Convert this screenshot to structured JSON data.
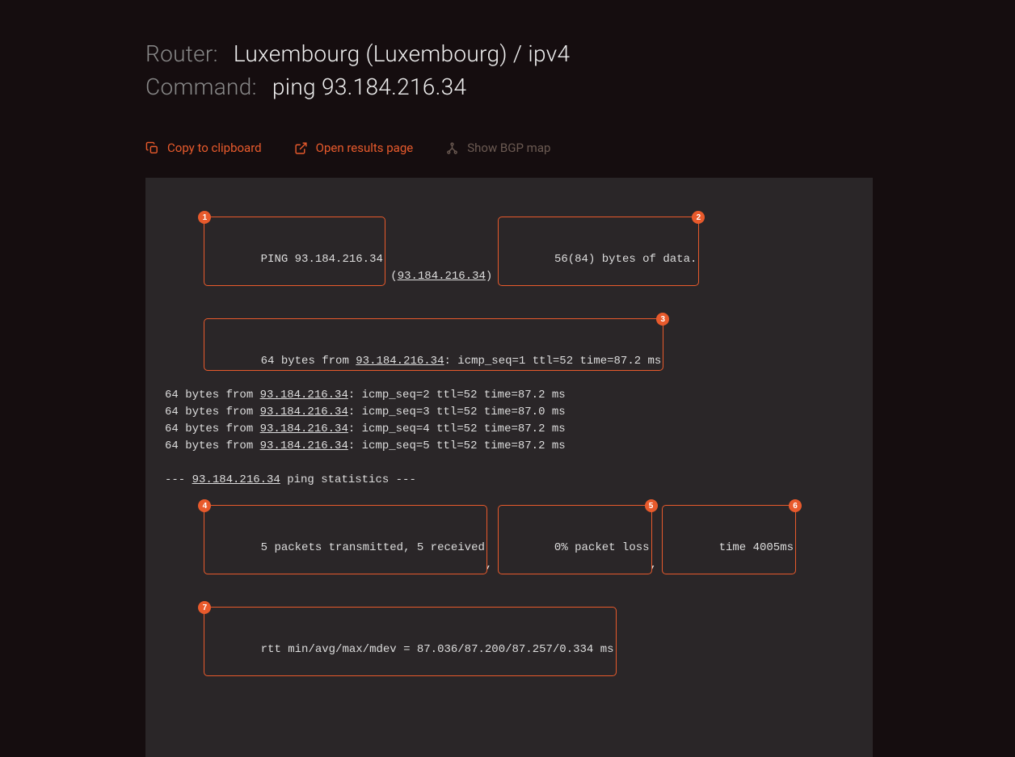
{
  "header": {
    "router_label": "Router:",
    "router_value": "Luxembourg (Luxembourg) / ipv4",
    "command_label": "Command:",
    "command_value": "ping 93.184.216.34"
  },
  "actions": {
    "copy": "Copy to clipboard",
    "open": "Open results page",
    "bgp": "Show BGP map"
  },
  "output": {
    "ip": "93.184.216.34",
    "line1_a": "PING 93.184.216.34",
    "line1_b": "56(84) bytes of data.",
    "line2": "64 bytes from 93.184.216.34: icmp_seq=1 ttl=52 time=87.2 ms",
    "seq_prefix": "64 bytes from ",
    "seq2": ": icmp_seq=2 ttl=52 time=87.2 ms",
    "seq3": ": icmp_seq=3 ttl=52 time=87.0 ms",
    "seq4": ": icmp_seq=4 ttl=52 time=87.2 ms",
    "seq5": ": icmp_seq=5 ttl=52 time=87.2 ms",
    "stats_title_a": "--- ",
    "stats_title_b": " ping statistics ---",
    "stats_a": "5 packets transmitted, 5 received",
    "stats_b": "0% packet loss",
    "stats_c": "time 4005ms",
    "rtt": "rtt min/avg/max/mdev = 87.036/87.200/87.257/0.334 ms"
  },
  "markers": {
    "m1": "1",
    "m2": "2",
    "m3": "3",
    "m4": "4",
    "m5": "5",
    "m6": "6",
    "m7": "7"
  }
}
